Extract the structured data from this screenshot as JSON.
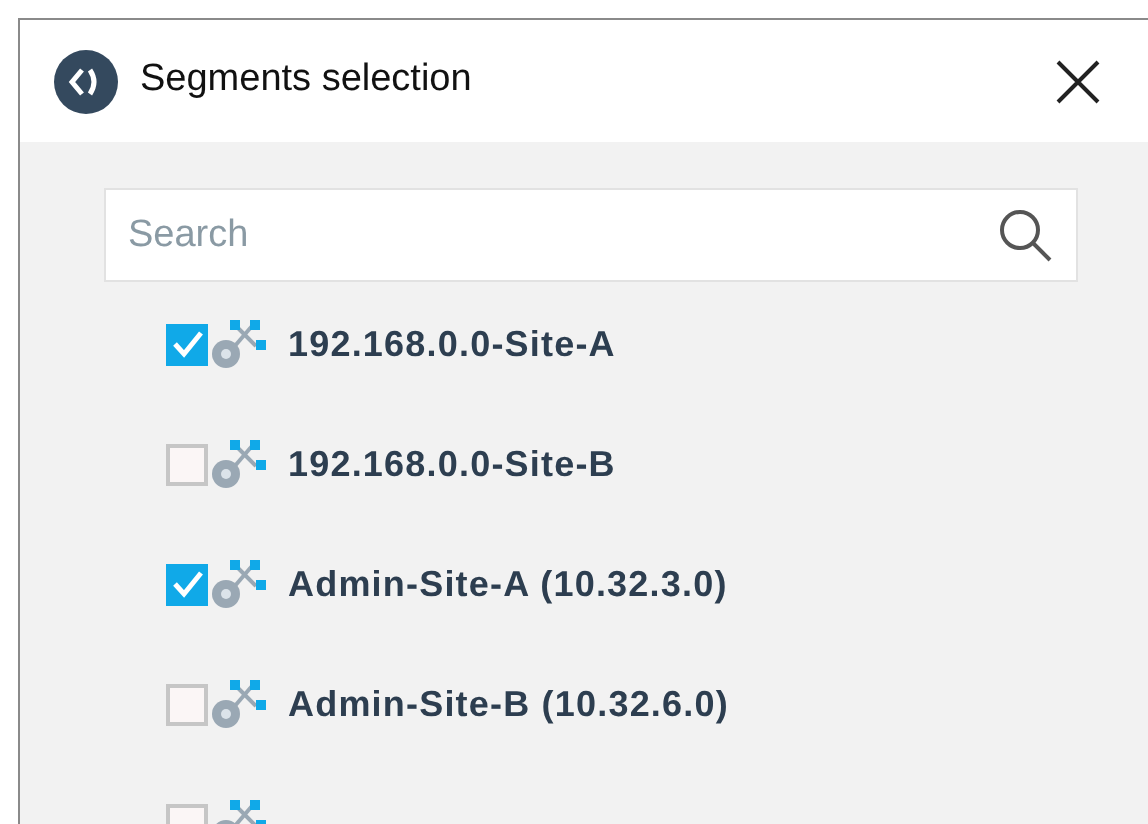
{
  "window": {
    "title": "Segments selection"
  },
  "search": {
    "placeholder": "Search"
  },
  "segments": [
    {
      "label": "192.168.0.0-Site-A",
      "checked": true
    },
    {
      "label": "192.168.0.0-Site-B",
      "checked": false
    },
    {
      "label": "Admin-Site-A (10.32.3.0)",
      "checked": true
    },
    {
      "label": "Admin-Site-B (10.32.6.0)",
      "checked": false
    },
    {
      "checked": false
    }
  ]
}
